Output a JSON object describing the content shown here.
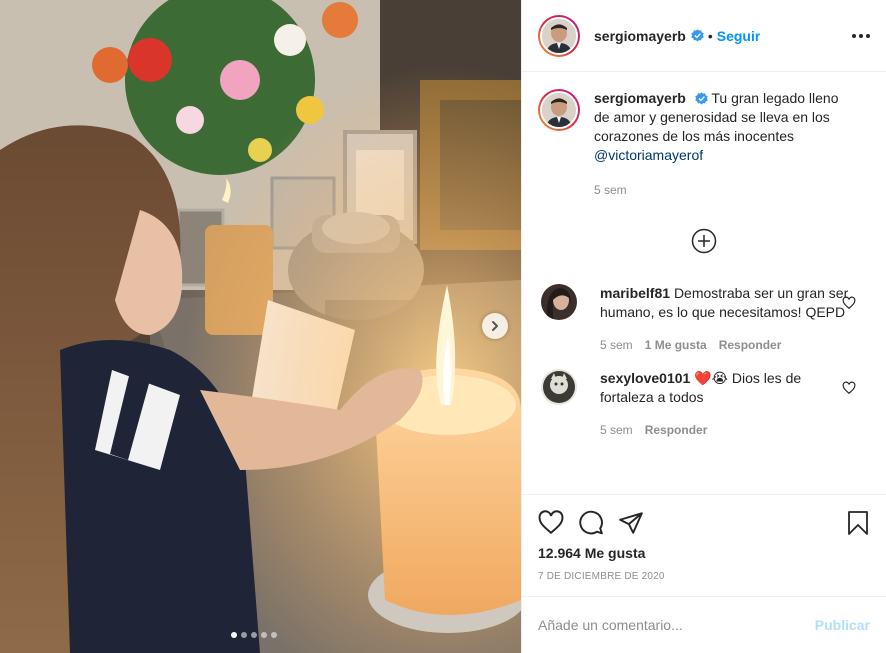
{
  "post": {
    "author": "sergiomayerb",
    "verified": true,
    "separator": "•",
    "follow_label": "Seguir",
    "caption": "Tu gran legado lleno de amor y generosidad se lleva en los corazones de los más inocentes",
    "caption_mention": "@victoriamayerof",
    "caption_time": "5 sem",
    "likes": "12.964 Me gusta",
    "date": "7 DE DICIEMBRE DE 2020",
    "carousel_total": 5,
    "carousel_index": 1
  },
  "comments": [
    {
      "user": "maribelf81",
      "text": "Demostraba ser un gran ser humano, es lo que necesitamos! QEPD",
      "time": "5 sem",
      "likes": "1 Me gusta",
      "reply_label": "Responder"
    },
    {
      "user": "sexylove0101",
      "emoji": "❤️😭",
      "text": "Dios les de fortaleza a todos",
      "time": "5 sem",
      "reply_label": "Responder"
    }
  ],
  "add_comment": {
    "placeholder": "Añade un comentario...",
    "publish_label": "Publicar"
  },
  "icons": {
    "more": "more-options-icon",
    "load_more": "plus-circle-icon",
    "like": "heart-icon",
    "comment": "comment-icon",
    "share": "paper-plane-icon",
    "save": "bookmark-icon",
    "next": "chevron-right-icon"
  },
  "colors": {
    "accent": "#0095f6",
    "publish_disabled": "#b2dffc",
    "muted": "#8e8e8e",
    "text": "#262626"
  }
}
